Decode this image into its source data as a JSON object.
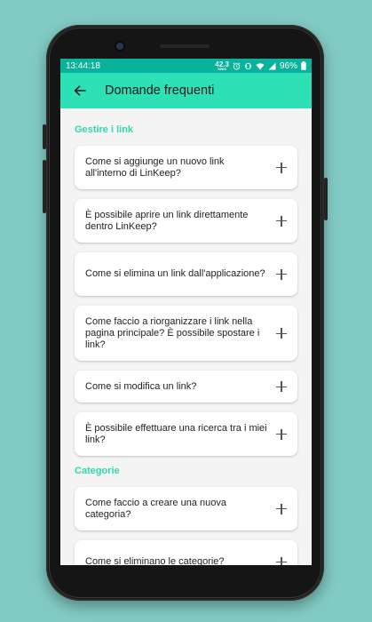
{
  "status_bar": {
    "time": "13:44:18",
    "speed_value": "42.3",
    "speed_unit": "KB/S",
    "battery": "96%"
  },
  "app_bar": {
    "title": "Domande frequenti",
    "back_icon": "arrow-left-icon"
  },
  "sections": [
    {
      "title": "Gestire i link",
      "items": [
        "Come si aggiunge un nuovo link all'interno di LinKeep?",
        "È possibile aprire un link direttamente dentro LinKeep?",
        "Come si elimina un link dall'applicazione?",
        "Come faccio a riorganizzare i link nella pagina principale? È possibile spostare i link?",
        "Come si modifica un link?",
        "È possibile effettuare una ricerca tra i miei link?"
      ]
    },
    {
      "title": "Categorie",
      "items": [
        "Come faccio a creare una nuova categoria?",
        "Come si eliminano le categorie?"
      ]
    }
  ],
  "colors": {
    "background": "#82cbc4",
    "status_bar": "#09b39b",
    "app_bar": "#2ee0b5",
    "section_title": "#2ed8b0"
  }
}
